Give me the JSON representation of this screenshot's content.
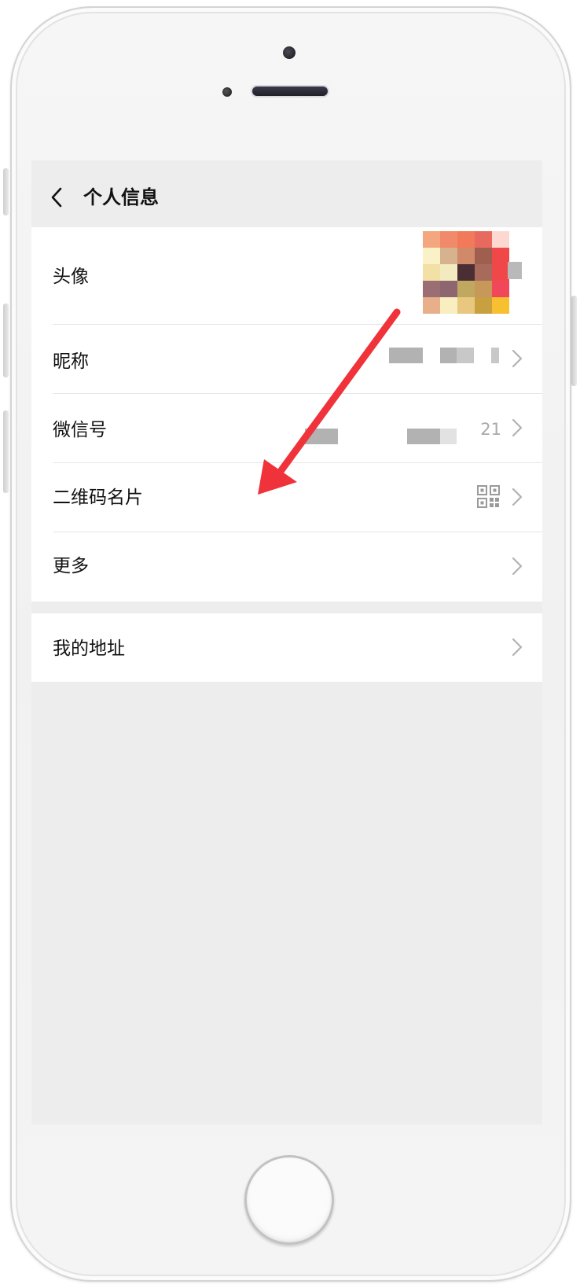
{
  "header": {
    "title": "个人信息",
    "back_icon": "chevron-left-icon"
  },
  "profile": {
    "avatar": {
      "label": "头像",
      "pixels": [
        [
          "#f4a67e",
          "#f08a6a",
          "#f07a5a",
          "#e86a5e",
          "#fcd8d0"
        ],
        [
          "#faf2c6",
          "#d7b28e",
          "#d08a6a",
          "#a05e4e",
          "#f04848"
        ],
        [
          "#f2e0a4",
          "#f4eac0",
          "#4a2e34",
          "#a86a5a",
          "#f04848"
        ],
        [
          "#9a6e72",
          "#8e6670",
          "#c0a860",
          "#c8985a",
          "#f04858"
        ],
        [
          "#e8b08a",
          "#f8eec0",
          "#e8c880",
          "#c8a040",
          "#f8c030"
        ]
      ]
    },
    "nickname": {
      "label": "昵称"
    },
    "wechat_id": {
      "label": "微信号",
      "value": "21"
    },
    "qr_card": {
      "label": "二维码名片",
      "icon": "qr-code-icon"
    },
    "more": {
      "label": "更多"
    }
  },
  "address": {
    "label": "我的地址"
  },
  "icons": {
    "row_arrow": "chevron-right-icon"
  },
  "colors": {
    "annotation_arrow": "#f0323a",
    "chevron": "#b2b2b2",
    "secondary_text": "#a9a9a9",
    "page_background": "#ededed"
  }
}
